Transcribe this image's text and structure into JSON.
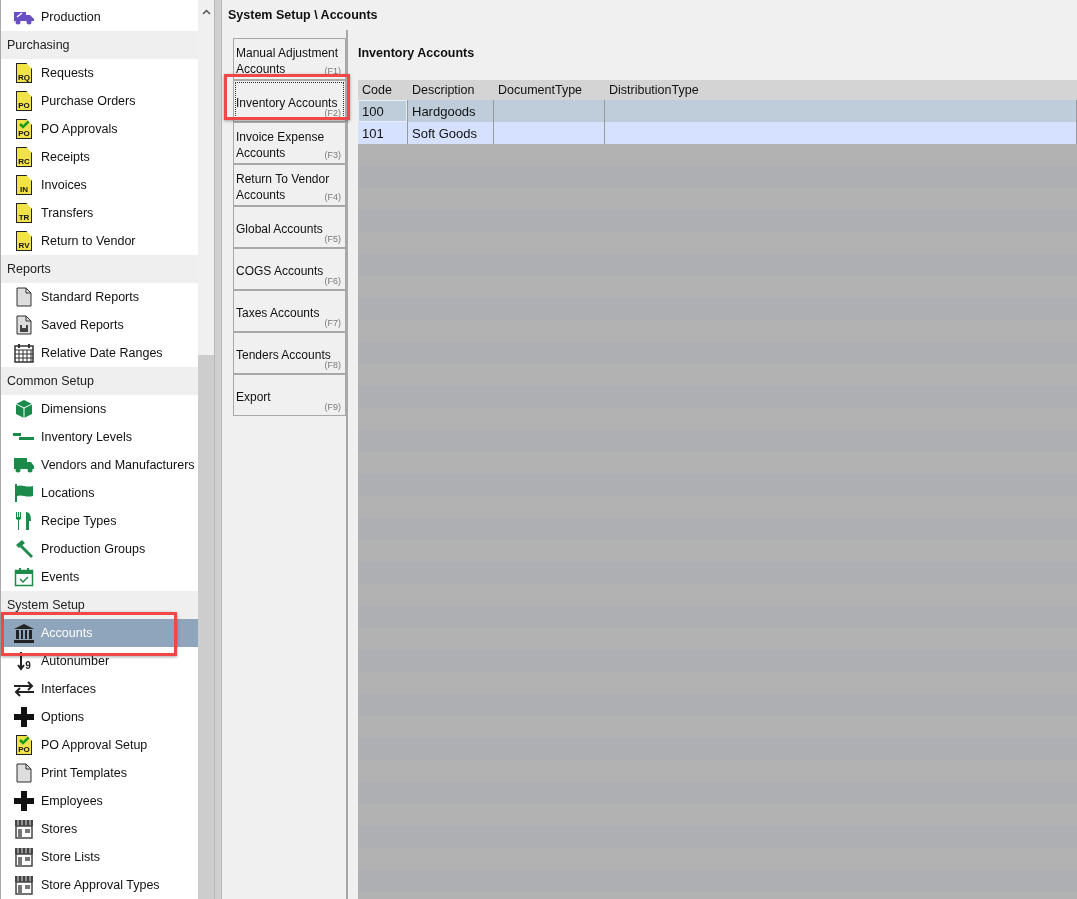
{
  "sidebar": {
    "items": [
      {
        "kind": "production",
        "label": "Production",
        "selected": false,
        "highlighted": false
      },
      {
        "kind": "header",
        "label": "Purchasing"
      },
      {
        "kind": "doc",
        "icon_text": "RQ",
        "label": "Requests",
        "selected": false,
        "highlighted": false
      },
      {
        "kind": "doc",
        "icon_text": "PO",
        "label": "Purchase Orders",
        "selected": false,
        "highlighted": false
      },
      {
        "kind": "doccheck",
        "icon_text": "PO",
        "label": "PO Approvals",
        "selected": false,
        "highlighted": false
      },
      {
        "kind": "doc",
        "icon_text": "RC",
        "label": "Receipts",
        "selected": false,
        "highlighted": false
      },
      {
        "kind": "doc",
        "icon_text": "IN",
        "label": "Invoices",
        "selected": false,
        "highlighted": false
      },
      {
        "kind": "doc",
        "icon_text": "TR",
        "label": "Transfers",
        "selected": false,
        "highlighted": false
      },
      {
        "kind": "doc",
        "icon_text": "RV",
        "label": "Return to Vendor",
        "selected": false,
        "highlighted": false
      },
      {
        "kind": "header",
        "label": "Reports"
      },
      {
        "kind": "report",
        "label": "Standard Reports",
        "selected": false,
        "highlighted": false
      },
      {
        "kind": "saved",
        "label": "Saved Reports",
        "selected": false,
        "highlighted": false
      },
      {
        "kind": "calendar",
        "label": "Relative Date Ranges",
        "selected": false,
        "highlighted": false
      },
      {
        "kind": "header",
        "label": "Common Setup"
      },
      {
        "kind": "cube",
        "label": "Dimensions",
        "selected": false,
        "highlighted": false
      },
      {
        "kind": "levels",
        "label": "Inventory Levels",
        "selected": false,
        "highlighted": false
      },
      {
        "kind": "truck",
        "label": "Vendors and Manufacturers",
        "selected": false,
        "highlighted": false
      },
      {
        "kind": "flag",
        "label": "Locations",
        "selected": false,
        "highlighted": false
      },
      {
        "kind": "cutlery",
        "label": "Recipe Types",
        "selected": false,
        "highlighted": false
      },
      {
        "kind": "hammer",
        "label": "Production Groups",
        "selected": false,
        "highlighted": false
      },
      {
        "kind": "event",
        "label": "Events",
        "selected": false,
        "highlighted": false
      },
      {
        "kind": "header",
        "label": "System Setup"
      },
      {
        "kind": "bank",
        "label": "Accounts",
        "selected": true,
        "highlighted": true
      },
      {
        "kind": "sort",
        "icon_text": "9",
        "label": "Autonumber",
        "selected": false,
        "highlighted": false
      },
      {
        "kind": "arrows",
        "label": "Interfaces",
        "selected": false,
        "highlighted": false
      },
      {
        "kind": "plus",
        "label": "Options",
        "selected": false,
        "highlighted": false
      },
      {
        "kind": "doccheck",
        "icon_text": "PO",
        "label": "PO Approval Setup",
        "selected": false,
        "highlighted": false
      },
      {
        "kind": "report",
        "label": "Print Templates",
        "selected": false,
        "highlighted": false
      },
      {
        "kind": "plus",
        "label": "Employees",
        "selected": false,
        "highlighted": false
      },
      {
        "kind": "store",
        "label": "Stores",
        "selected": false,
        "highlighted": false
      },
      {
        "kind": "store",
        "label": "Store Lists",
        "selected": false,
        "highlighted": false
      },
      {
        "kind": "store",
        "label": "Store Approval Types",
        "selected": false,
        "highlighted": false
      }
    ]
  },
  "breadcrumb": "System Setup \\ Accounts",
  "tabs": [
    {
      "label": "Manual Adjustment Accounts",
      "shortcut": "(F1)",
      "selected": false,
      "highlighted": false
    },
    {
      "label": "Inventory Accounts",
      "shortcut": "(F2)",
      "selected": true,
      "highlighted": true
    },
    {
      "label": "Invoice Expense Accounts",
      "shortcut": "(F3)",
      "selected": false,
      "highlighted": false
    },
    {
      "label": "Return To Vendor Accounts",
      "shortcut": "(F4)",
      "selected": false,
      "highlighted": false
    },
    {
      "label": "Global Accounts",
      "shortcut": "(F5)",
      "selected": false,
      "highlighted": false
    },
    {
      "label": "COGS Accounts",
      "shortcut": "(F6)",
      "selected": false,
      "highlighted": false
    },
    {
      "label": "Taxes Accounts",
      "shortcut": "(F7)",
      "selected": false,
      "highlighted": false
    },
    {
      "label": "Tenders Accounts",
      "shortcut": "(F8)",
      "selected": false,
      "highlighted": false
    },
    {
      "label": "Export",
      "shortcut": "(F9)",
      "selected": false,
      "highlighted": false
    }
  ],
  "panel_title": "Inventory Accounts",
  "table": {
    "columns": [
      "Code",
      "Description",
      "DocumentType",
      "DistributionType"
    ],
    "rows": [
      {
        "cells": [
          "100",
          "Hardgoods",
          "",
          ""
        ],
        "selected": true
      },
      {
        "cells": [
          "101",
          "Soft Goods",
          "",
          ""
        ],
        "selected": false
      }
    ]
  }
}
